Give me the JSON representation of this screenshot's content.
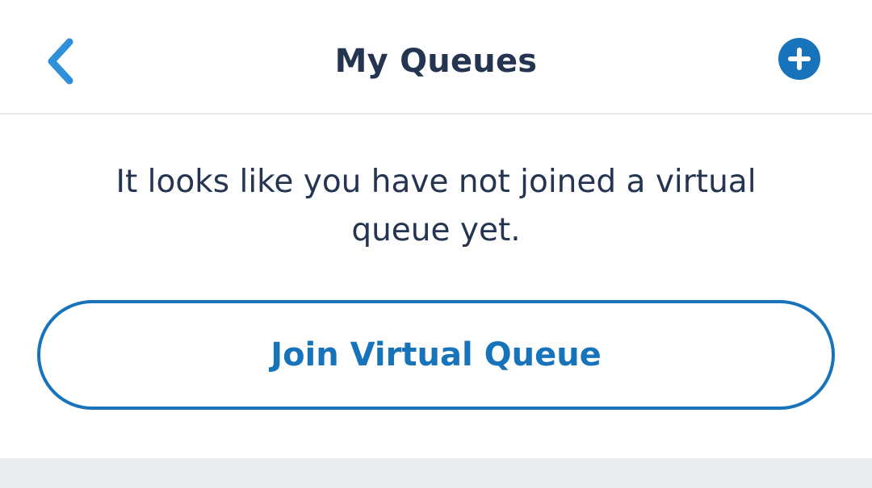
{
  "header": {
    "title": "My Queues",
    "back_icon": "chevron-left-icon",
    "add_icon": "plus-circle-icon"
  },
  "empty_state": {
    "message": "It looks like you have not joined a virtual queue yet."
  },
  "actions": {
    "join_label": "Join Virtual Queue"
  },
  "colors": {
    "accent": "#1773ba",
    "title_text": "#253551",
    "divider": "#e6e8ec",
    "footer_bg": "#e9ecef"
  }
}
